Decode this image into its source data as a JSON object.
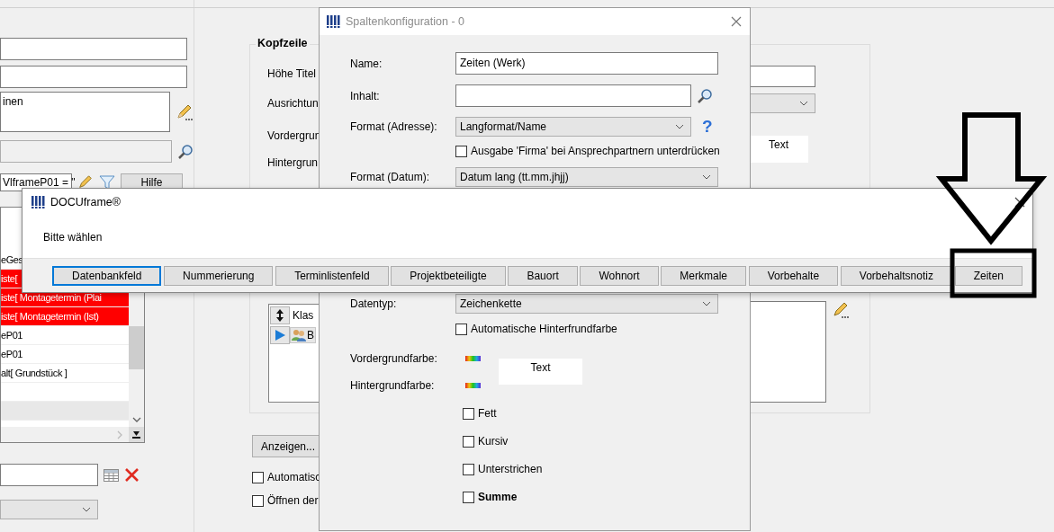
{
  "main_window": {
    "left_panel": {
      "notes_value": "inen",
      "filter_value": "VlframeP01 = \"",
      "help_button": "Hilfe",
      "list_rows": [
        {
          "text": "eGes",
          "highlighted": false
        },
        {
          "text": "iste[",
          "highlighted": true
        },
        {
          "text": "iste[ Montagetermin (Plai",
          "highlighted": true
        },
        {
          "text": "iste[ Montagetermin (Ist)",
          "highlighted": true
        },
        {
          "text": "eP01",
          "highlighted": false
        },
        {
          "text": "eP01",
          "highlighted": false
        },
        {
          "text": "alt[ Grundstück ]",
          "highlighted": false
        }
      ]
    },
    "header_group": {
      "title": "Kopfzeile",
      "labels": [
        "Höhe Titel",
        "Ausrichtun",
        "Vordergrun",
        "Hintergrun"
      ],
      "preview_text": "Text",
      "class_list": [
        {
          "text": "Klas",
          "kind": "header"
        },
        {
          "text": "B",
          "kind": "row"
        }
      ]
    },
    "show_button": "Anzeigen...",
    "checkboxes": [
      {
        "label": "Automatisc",
        "checked": false
      },
      {
        "label": "Öffnen der",
        "checked": false
      }
    ]
  },
  "column_dialog": {
    "title": "Spaltenkonfiguration - 0",
    "name_label": "Name:",
    "name_value": "Zeiten (Werk)",
    "content_label": "Inhalt:",
    "address_format_label": "Format (Adresse):",
    "address_format_value": "Langformat/Name",
    "help_icon": "?",
    "suppress_company": {
      "label": "Ausgabe 'Firma' bei Ansprechpartnern unterdrücken",
      "checked": false
    },
    "date_format_label": "Format (Datum):",
    "date_format_value": "Datum lang (tt.mm.jhjj)",
    "data_type_label": "Datentyp:",
    "data_type_value": "Zeichenkette",
    "auto_background": {
      "label": "Automatische Hinterfrundfarbe",
      "checked": false
    },
    "foreground_label": "Vordergrundfarbe:",
    "background_label": "Hintergrundfarbe:",
    "preview_text": "Text",
    "style_options": [
      {
        "label": "Fett",
        "checked": false,
        "bold": false
      },
      {
        "label": "Kursiv",
        "checked": false,
        "bold": false
      },
      {
        "label": "Unterstrichen",
        "checked": false,
        "bold": false
      },
      {
        "label": "Summe",
        "checked": false,
        "bold": true
      }
    ]
  },
  "choice_dialog": {
    "title": "DOCUframe®",
    "prompt": "Bitte wählen",
    "buttons": [
      {
        "label": "Datenbankfeld",
        "focused": true
      },
      {
        "label": "Nummerierung",
        "focused": false
      },
      {
        "label": "Terminlistenfeld",
        "focused": false
      },
      {
        "label": "Projektbeteiligte",
        "focused": false
      },
      {
        "label": "Bauort",
        "focused": false
      },
      {
        "label": "Wohnort",
        "focused": false
      },
      {
        "label": "Merkmale",
        "focused": false
      },
      {
        "label": "Vorbehalte",
        "focused": false
      },
      {
        "label": "Vorbehaltsnotiz",
        "focused": false
      },
      {
        "label": "Zeiten",
        "focused": false
      }
    ]
  }
}
